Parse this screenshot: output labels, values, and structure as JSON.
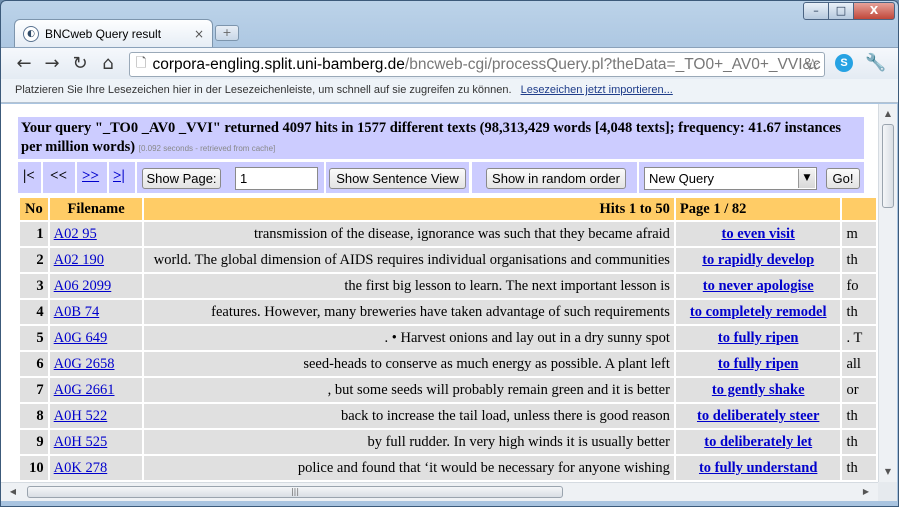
{
  "browser": {
    "tab_title": "BNCweb Query result",
    "tab_close": "×",
    "new_tab": "+",
    "url_host": "corpora-engling.split.uni-bamberg.de",
    "url_path": "/bncweb-cgi/processQuery.pl?theData=_TO0+_AV0+_VVI&c",
    "bookmark_text": "Platzieren Sie Ihre Lesezeichen hier in der Lesezeichenleiste, um schnell auf sie zugreifen zu können.",
    "bookmark_link": "Lesezeichen jetzt importieren...",
    "window_controls": {
      "minimize": "–",
      "maximize": "□",
      "close": "X"
    }
  },
  "query": {
    "summary": "Your query \"_TO0 _AV0 _VVI\" returned 4097 hits in 1577 different texts (98,313,429 words [4,048 texts]; frequency: 41.67 instances per million words)",
    "timing": "[0.092 seconds - retrieved from cache]"
  },
  "controls": {
    "first": "|<",
    "prev": "<<",
    "next": ">>",
    "last": ">|",
    "show_page_label": "Show Page:",
    "page_value": "1",
    "sentence_view_label": "Show Sentence View",
    "random_order_label": "Show in random order",
    "new_query_selected": "New Query",
    "go_label": "Go!"
  },
  "table": {
    "headers": {
      "no": "No",
      "filename": "Filename",
      "hits": "Hits 1 to 50",
      "page": "Page 1 / 82"
    },
    "rows": [
      {
        "no": "1",
        "file": "A02 95",
        "left": "transmission of the disease, ignorance was such that they became afraid",
        "node": "to even visit",
        "right": "m"
      },
      {
        "no": "2",
        "file": "A02 190",
        "left": "world. The global dimension of AIDS requires individual organisations and communities",
        "node": "to rapidly develop",
        "right": "th"
      },
      {
        "no": "3",
        "file": "A06 2099",
        "left": "the first big lesson to learn. The next important lesson is",
        "node": "to never apologise",
        "right": "fo"
      },
      {
        "no": "4",
        "file": "A0B 74",
        "left": "features. However, many breweries have taken advantage of such requirements",
        "node": "to completely remodel",
        "right": "th"
      },
      {
        "no": "5",
        "file": "A0G 649",
        "left": ". • Harvest onions and lay out in a dry sunny spot",
        "node": "to fully ripen",
        "right": ". T"
      },
      {
        "no": "6",
        "file": "A0G 2658",
        "left": "seed-heads to conserve as much energy as possible. A plant left",
        "node": "to fully ripen",
        "right": "all"
      },
      {
        "no": "7",
        "file": "A0G 2661",
        "left": ", but some seeds will probably remain green and it is better",
        "node": "to gently shake",
        "right": "or"
      },
      {
        "no": "8",
        "file": "A0H 522",
        "left": "back to increase the tail load, unless there is good reason",
        "node": "to deliberately steer",
        "right": "th"
      },
      {
        "no": "9",
        "file": "A0H 525",
        "left": "by full rudder. In very high winds it is usually better",
        "node": "to deliberately let",
        "right": "th"
      },
      {
        "no": "10",
        "file": "A0K 278",
        "left": "police and found that ‘it would be necessary for anyone wishing",
        "node": "to fully understand",
        "right": "th"
      }
    ]
  }
}
